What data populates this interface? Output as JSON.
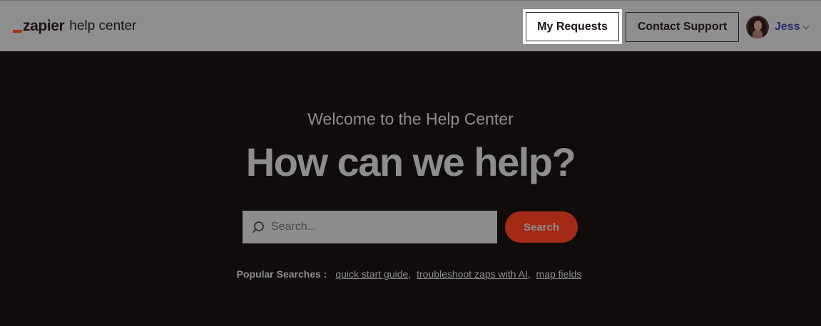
{
  "header": {
    "logo": {
      "word": "zapier",
      "sub": "help center",
      "mark_color": "#a2321b"
    },
    "my_requests_label": "My Requests",
    "contact_support_label": "Contact Support",
    "user": {
      "name": "Jess",
      "avatar_icon": "user-avatar",
      "chevron_icon": "chevron-down-icon"
    }
  },
  "hero": {
    "welcome": "Welcome to the Help Center",
    "headline": "How can we help?",
    "search": {
      "placeholder": "Search...",
      "icon": "search-icon",
      "button_label": "Search",
      "button_color": "#a32b16"
    },
    "popular": {
      "label": "Popular Searches :",
      "links": [
        "quick start guide,",
        "troubleshoot zaps with AI,",
        "map fields"
      ]
    }
  },
  "colors": {
    "header_bg": "#8e8e8e",
    "hero_bg": "#100c0c",
    "muted_text": "#8d8d8d"
  }
}
